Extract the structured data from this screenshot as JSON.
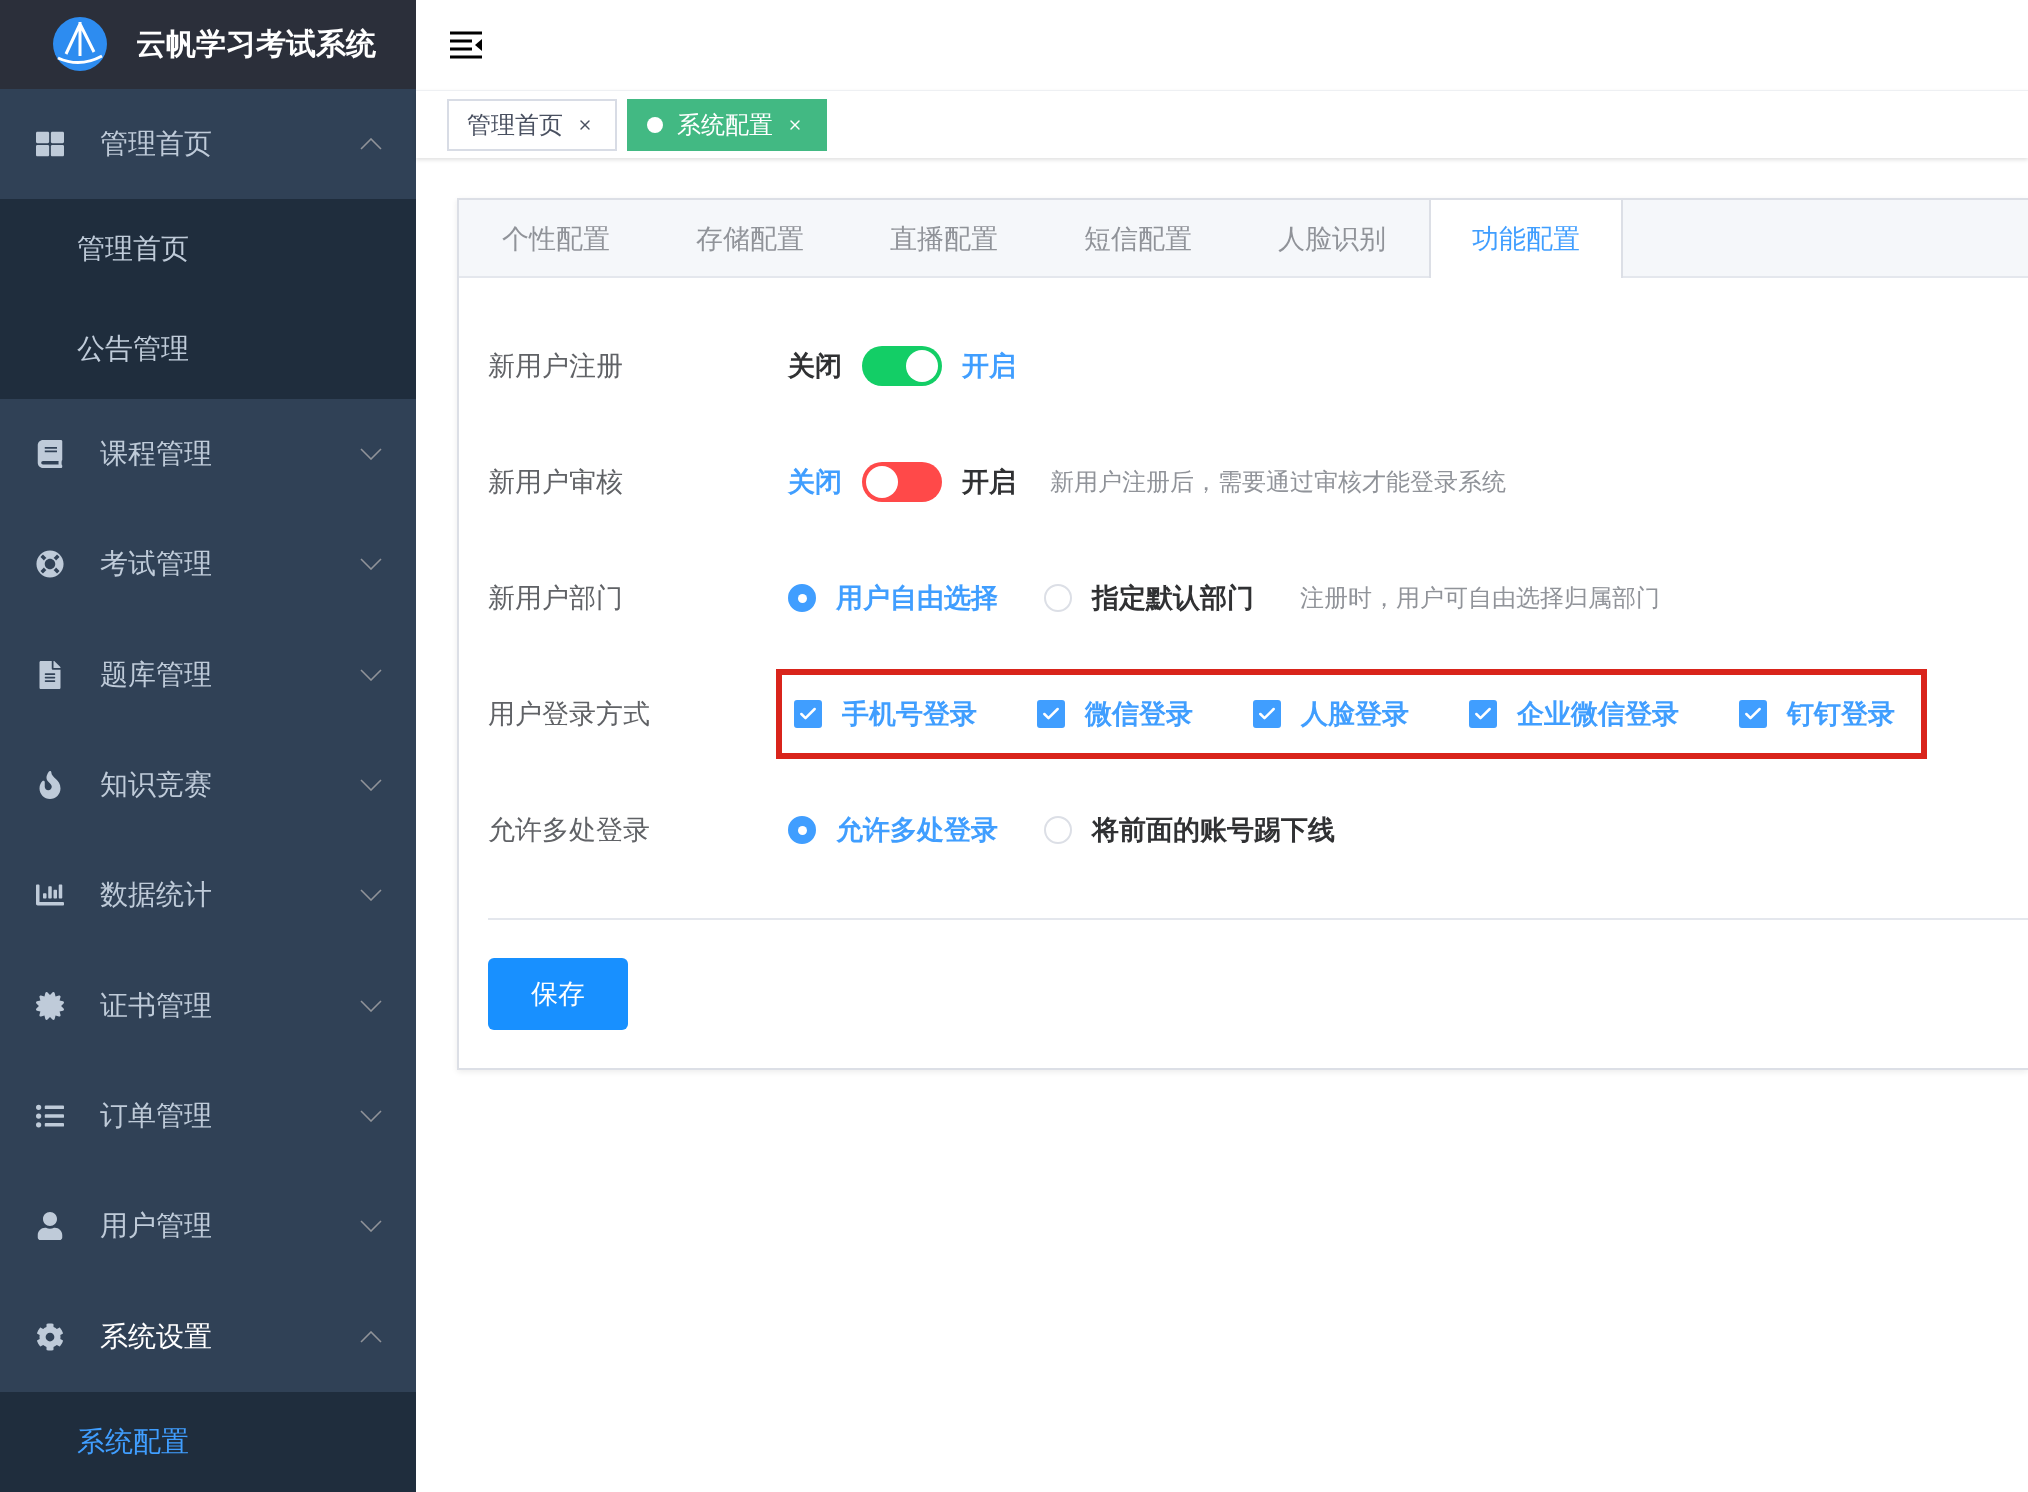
{
  "app": {
    "title": "云帆学习考试系统"
  },
  "sidebar": {
    "items": [
      {
        "label": "管理首页",
        "expanded": true,
        "children": [
          {
            "label": "管理首页",
            "selected": false
          },
          {
            "label": "公告管理",
            "selected": false
          }
        ]
      },
      {
        "label": "课程管理",
        "expanded": false
      },
      {
        "label": "考试管理",
        "expanded": false
      },
      {
        "label": "题库管理",
        "expanded": false
      },
      {
        "label": "知识竞赛",
        "expanded": false
      },
      {
        "label": "数据统计",
        "expanded": false
      },
      {
        "label": "证书管理",
        "expanded": false
      },
      {
        "label": "订单管理",
        "expanded": false
      },
      {
        "label": "用户管理",
        "expanded": false
      },
      {
        "label": "系统设置",
        "expanded": true,
        "children": [
          {
            "label": "系统配置",
            "selected": true
          }
        ]
      }
    ]
  },
  "tags": [
    {
      "label": "管理首页",
      "selected": false
    },
    {
      "label": "系统配置",
      "selected": true
    }
  ],
  "tabs": [
    {
      "label": "个性配置",
      "selected": false
    },
    {
      "label": "存储配置",
      "selected": false
    },
    {
      "label": "直播配置",
      "selected": false
    },
    {
      "label": "短信配置",
      "selected": false
    },
    {
      "label": "人脸识别",
      "selected": false
    },
    {
      "label": "功能配置",
      "selected": true
    }
  ],
  "form": {
    "rows": [
      {
        "kind": "switch",
        "label": "新用户注册",
        "off_label": "关闭",
        "on_label": "开启",
        "on": true
      },
      {
        "kind": "switch",
        "label": "新用户审核",
        "off_label": "关闭",
        "on_label": "开启",
        "on": false,
        "hint": "新用户注册后，需要通过审核才能登录系统"
      },
      {
        "kind": "radio",
        "label": "新用户部门",
        "options": [
          {
            "label": "用户自由选择",
            "selected": true
          },
          {
            "label": "指定默认部门",
            "selected": false
          }
        ],
        "hint": "注册时，用户可自由选择归属部门"
      },
      {
        "kind": "checkbox",
        "label": "用户登录方式",
        "highlighted": true,
        "options": [
          {
            "label": "手机号登录",
            "checked": true
          },
          {
            "label": "微信登录",
            "checked": true
          },
          {
            "label": "人脸登录",
            "checked": true
          },
          {
            "label": "企业微信登录",
            "checked": true
          },
          {
            "label": "钉钉登录",
            "checked": true
          }
        ]
      },
      {
        "kind": "radio",
        "label": "允许多处登录",
        "options": [
          {
            "label": "允许多处登录",
            "selected": true
          },
          {
            "label": "将前面的账号踢下线",
            "selected": false
          }
        ]
      }
    ],
    "save_button": "保存"
  }
}
